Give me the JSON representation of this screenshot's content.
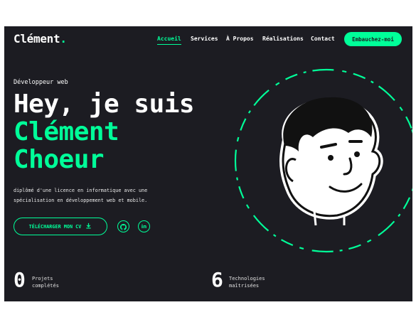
{
  "header": {
    "logo_text": "Clément",
    "logo_dot": ".",
    "nav": [
      "Accueil",
      "Services",
      "À Propos",
      "Réalisations",
      "Contact"
    ],
    "active_nav": "Accueil",
    "cta": "Embauchez-moi"
  },
  "hero": {
    "eyebrow": "Développeur web",
    "line1": "Hey, je suis",
    "line2": "Clément",
    "line3": "Choeur",
    "description": "diplômé d'une licence en informatique avec une spécialisation en développement web et mobile.",
    "download_cv": "TÉLÉCHARGER MON CV",
    "socials": [
      "github-icon",
      "linkedin-icon"
    ]
  },
  "stats": [
    {
      "value": "0",
      "label_line1": "Projets",
      "label_line2": "complétés"
    },
    {
      "value": "6",
      "label_line1": "Technologies",
      "label_line2": "maîtrisées"
    }
  ],
  "colors": {
    "background": "#1c1c22",
    "accent": "#00ff99",
    "text": "#ffffff"
  }
}
